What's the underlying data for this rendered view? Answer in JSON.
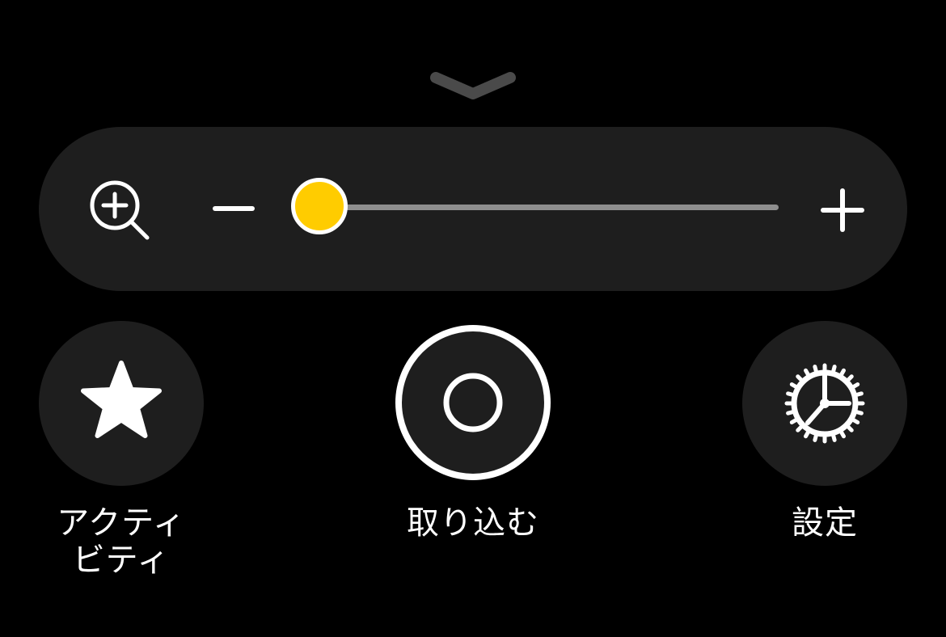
{
  "zoom": {
    "level": 0.0
  },
  "buttons": {
    "activity_label_line1": "アクティ",
    "activity_label_line2": "ビティ",
    "capture_label": "取り込む",
    "settings_label": "設定"
  },
  "icons": {
    "collapse": "chevron-down-icon",
    "zoom": "zoom-in-icon",
    "minus": "minus-icon",
    "plus": "plus-icon",
    "activity": "star-icon",
    "capture": "shutter-icon",
    "settings": "gear-icon"
  },
  "colors": {
    "background": "#000000",
    "panel": "#1e1e1e",
    "accent": "#ffcc00",
    "track": "#8e8e8e",
    "foreground": "#ffffff"
  }
}
